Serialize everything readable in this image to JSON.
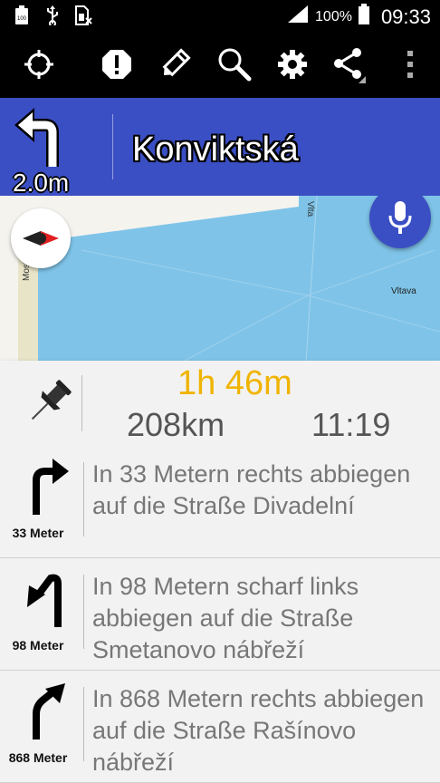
{
  "status_bar": {
    "left_icons": [
      "battery-full-notification-icon",
      "usb-icon",
      "sim-card-icon"
    ],
    "battery_label": "100",
    "signal_icon": "signal-icon",
    "battery_percent": "100%",
    "time": "09:33"
  },
  "toolbar": {
    "icons": [
      "crosshair-icon",
      "warning-icon",
      "edit-icon",
      "search-icon",
      "gear-icon",
      "share-icon",
      "overflow-menu-icon"
    ]
  },
  "direction": {
    "distance": "2.0m",
    "street": "Konviktská",
    "turn_icon": "turn-left-arrow-icon"
  },
  "map": {
    "labels": {
      "river": "Vltava",
      "street_left": "Most",
      "street_top": "Vlta"
    },
    "colors": {
      "water": "#7fc4e8",
      "land": "#f5f3ee",
      "road": "#e8e4c8"
    }
  },
  "summary": {
    "duration": "1h 46m",
    "distance": "208km",
    "arrival": "11:19",
    "pin_icon": "pushpin-icon"
  },
  "steps": [
    {
      "distance_label": "33 Meter",
      "instruction": "In 33 Metern rechts abbiegen auf die Straße Divadelní",
      "icon": "turn-right-arrow-icon"
    },
    {
      "distance_label": "98 Meter",
      "instruction": "In 98 Metern scharf links abbiegen auf die Straße Smetanovo nábřeží",
      "icon": "sharp-left-arrow-icon"
    },
    {
      "distance_label": "868 Meter",
      "instruction": "In 868 Metern rechts abbiegen auf die Straße Rašínovo nábřeží",
      "icon": "slight-right-arrow-icon"
    }
  ],
  "colors": {
    "header_blue": "#3b4fc4",
    "duration_orange": "#f0b400",
    "text_gray": "#777777"
  }
}
